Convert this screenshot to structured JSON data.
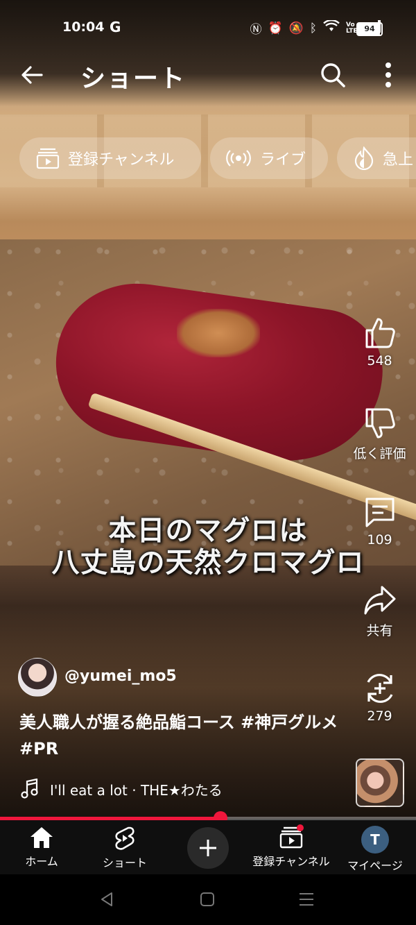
{
  "status_bar": {
    "time": "10:04",
    "g_label": "G",
    "battery": "94",
    "battery_level": 0.94,
    "volte_label": "Vo LTE"
  },
  "header": {
    "title": "ショート"
  },
  "chips": [
    {
      "label": "登録チャンネル"
    },
    {
      "label": "ライブ"
    },
    {
      "label": "急上"
    }
  ],
  "video": {
    "caption_line1": "本日のマグロは",
    "caption_line2": "八丈島の天然クロマグロ"
  },
  "actions": {
    "like_count": "548",
    "dislike_label": "低く評価",
    "comment_count": "109",
    "share_label": "共有",
    "remix_count": "279"
  },
  "channel": {
    "handle": "@yumei_mo5"
  },
  "description": {
    "text": "美人職人が握る絶品鮨コース ",
    "tag1": "#神戸グルメ",
    "tag2": "#PR"
  },
  "music": {
    "label": "I'll eat a lot · THE★わたる"
  },
  "progress": {
    "fraction": 0.53,
    "color": "#f0173c"
  },
  "bottom_nav": {
    "home": "ホーム",
    "shorts": "ショート",
    "subscriptions": "登録チャンネル",
    "me": "マイページ",
    "me_initial": "T"
  }
}
